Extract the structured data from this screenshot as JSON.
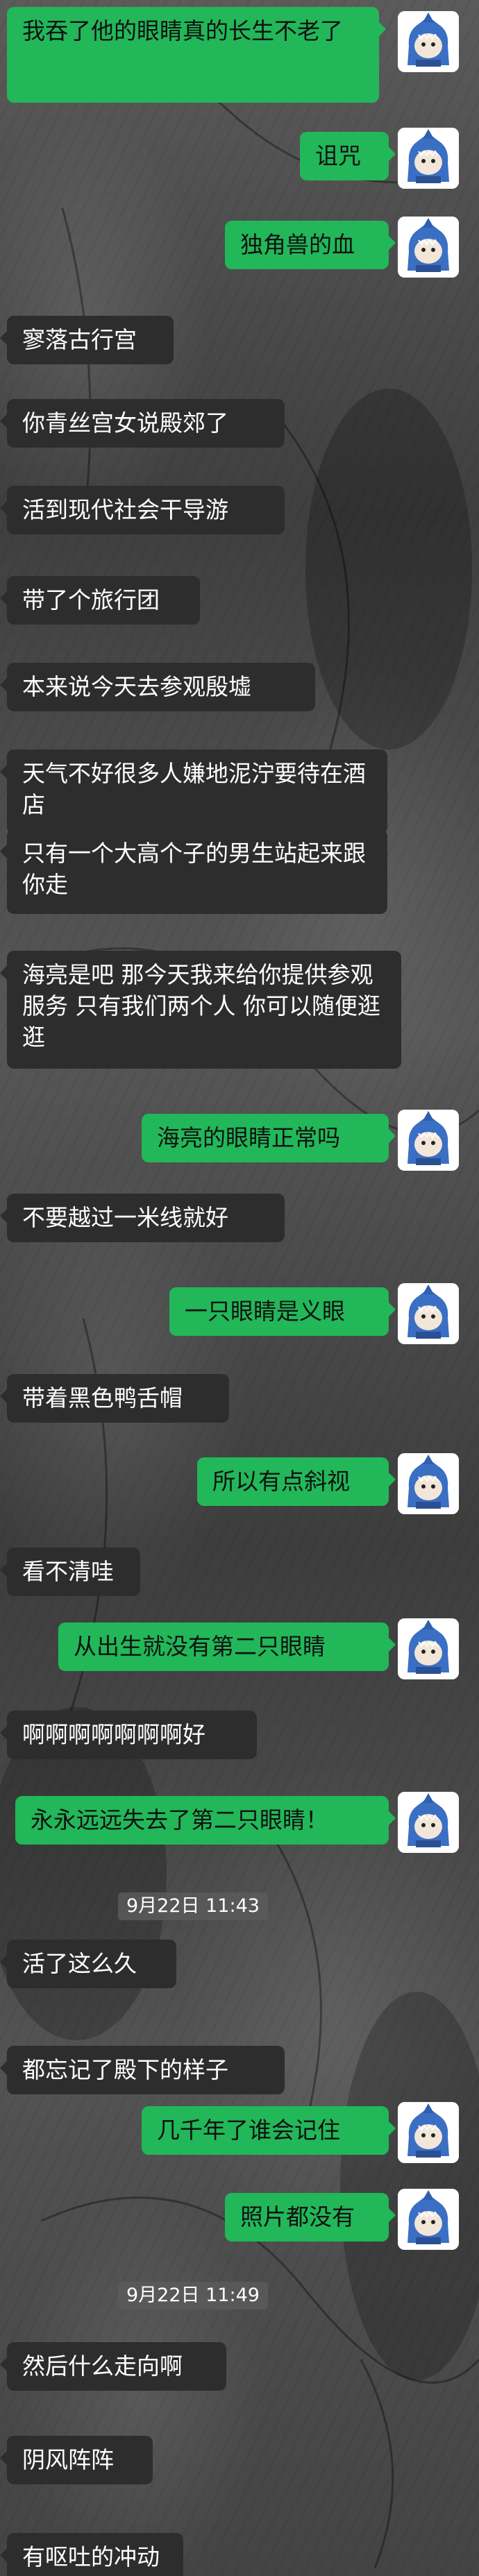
{
  "messages": [
    {
      "side": "out",
      "text": "我吞了他的眼睛真的长生不老了"
    },
    {
      "side": "out",
      "text": "诅咒"
    },
    {
      "side": "out",
      "text": "独角兽的血"
    },
    {
      "side": "in",
      "text": "寥落古行宫"
    },
    {
      "side": "in",
      "text": "你青丝宫女说殿郊了"
    },
    {
      "side": "in",
      "text": "活到现代社会干导游"
    },
    {
      "side": "in",
      "text": "带了个旅行团"
    },
    {
      "side": "in",
      "text": "本来说今天去参观殷墟"
    },
    {
      "side": "in",
      "text": "天气不好很多人嫌地泥泞要待在酒店"
    },
    {
      "side": "in",
      "text": "只有一个大高个子的男生站起来跟你走"
    },
    {
      "side": "in",
      "text": "海亮是吧 那今天我来给你提供参观服务 只有我们两个人 你可以随便逛逛"
    },
    {
      "side": "out",
      "text": "海亮的眼睛正常吗"
    },
    {
      "side": "in",
      "text": "不要越过一米线就好"
    },
    {
      "side": "out",
      "text": "一只眼睛是义眼"
    },
    {
      "side": "in",
      "text": "带着黑色鸭舌帽"
    },
    {
      "side": "out",
      "text": "所以有点斜视"
    },
    {
      "side": "in",
      "text": "看不清哇"
    },
    {
      "side": "out",
      "text": "从出生就没有第二只眼睛"
    },
    {
      "side": "in",
      "text": "啊啊啊啊啊啊啊好"
    },
    {
      "side": "out",
      "text": "永永远远失去了第二只眼睛！"
    },
    {
      "side": "time",
      "text": "9月22日 11:43"
    },
    {
      "side": "in",
      "text": "活了这么久"
    },
    {
      "side": "in",
      "text": "都忘记了殿下的样子"
    },
    {
      "side": "out",
      "text": "几千年了谁会记住"
    },
    {
      "side": "out",
      "text": "照片都没有"
    },
    {
      "side": "time",
      "text": "9月22日 11:49"
    },
    {
      "side": "in",
      "text": "然后什么走向啊"
    },
    {
      "side": "in",
      "text": "阴风阵阵"
    },
    {
      "side": "in",
      "text": "有呕吐的冲动"
    }
  ],
  "avatar_icon": "blue-shark-hoodie-avatar-icon",
  "colors": {
    "outgoing": "#22b759",
    "incoming": "#2d2d2d"
  }
}
